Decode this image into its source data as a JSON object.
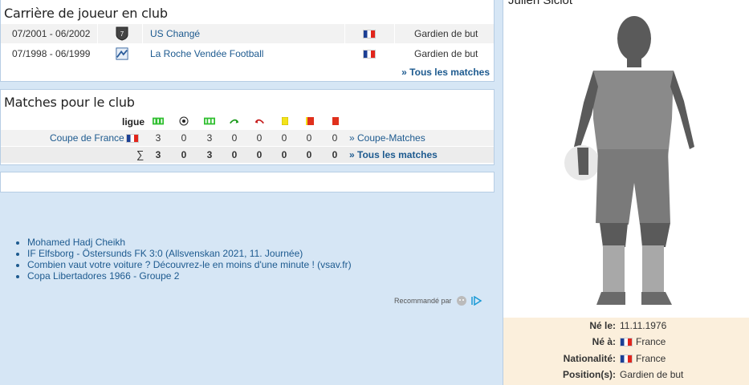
{
  "career": {
    "title": "Carrière de joueur en club",
    "rows": [
      {
        "period": "07/2001 - 06/2002",
        "club": "US Changé",
        "position": "Gardien de but",
        "logo_icon": "us-change-logo-icon"
      },
      {
        "period": "07/1998 - 06/1999",
        "club": "La Roche Vendée Football",
        "position": "Gardien de but",
        "logo_icon": "la-roche-vendee-logo-icon"
      }
    ],
    "all_matches_link": "» Tous les matches"
  },
  "club_matches": {
    "title": "Matches pour le club",
    "header_league": "ligue",
    "header_icons": [
      "lineup-icon",
      "goal-ball-icon",
      "substitute-icon",
      "sub-in-arrow-icon",
      "sub-out-arrow-icon",
      "yellow-card-icon",
      "yellow-red-card-icon",
      "red-card-icon"
    ],
    "rows": [
      {
        "competition": "Coupe de France",
        "values": [
          "3",
          "0",
          "3",
          "0",
          "0",
          "0",
          "0",
          "0"
        ],
        "link": "» Coupe-Matches"
      }
    ],
    "total": {
      "symbol": "∑",
      "values": [
        "3",
        "0",
        "3",
        "0",
        "0",
        "0",
        "0",
        "0"
      ],
      "link": "» Tous les matches"
    }
  },
  "recommended": {
    "items": [
      "Mohamed Hadj Cheikh",
      "IF Elfsborg - Östersunds FK 3:0 (Allsvenskan 2021, 11. Journée)",
      "Combien vaut votre voiture ? Découvrez-le en moins d'une minute ! (vsav.fr)",
      "Copa Libertadores 1966 - Groupe 2"
    ],
    "by_label": "Recommandé par"
  },
  "player": {
    "name": "Julien Siciot",
    "info": [
      {
        "label": "Né le:",
        "value": "11.11.1976",
        "flag": false
      },
      {
        "label": "Né à:",
        "value": "France",
        "flag": true
      },
      {
        "label": "Nationalité:",
        "value": "France",
        "flag": true
      },
      {
        "label": "Position(s):",
        "value": "Gardien de but",
        "flag": false
      }
    ]
  },
  "colors": {
    "link": "#1d5a8f",
    "panel_border": "#b6cde4",
    "background": "#d6e6f5",
    "info_bg": "#fbefdc"
  }
}
